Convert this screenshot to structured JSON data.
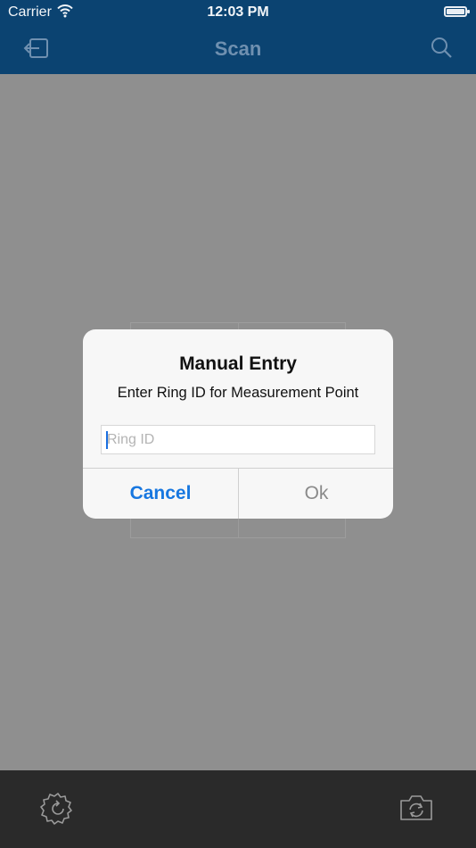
{
  "status_bar": {
    "carrier": "Carrier",
    "time": "12:03 PM",
    "wifi_icon": "wifi-icon",
    "battery_icon": "battery-icon"
  },
  "nav": {
    "title": "Scan",
    "back_icon": "back-arrow-icon",
    "search_icon": "search-icon"
  },
  "dialog": {
    "title": "Manual Entry",
    "message": "Enter Ring ID for Measurement Point",
    "input_placeholder": "Ring ID",
    "input_value": "",
    "cancel_label": "Cancel",
    "ok_label": "Ok"
  },
  "toolbar": {
    "settings_icon": "settings-refresh-icon",
    "camera_switch_icon": "camera-switch-icon"
  },
  "colors": {
    "nav_bg": "#0b4371",
    "accent": "#1777e0",
    "toolbar_bg": "#2a2a2a"
  }
}
